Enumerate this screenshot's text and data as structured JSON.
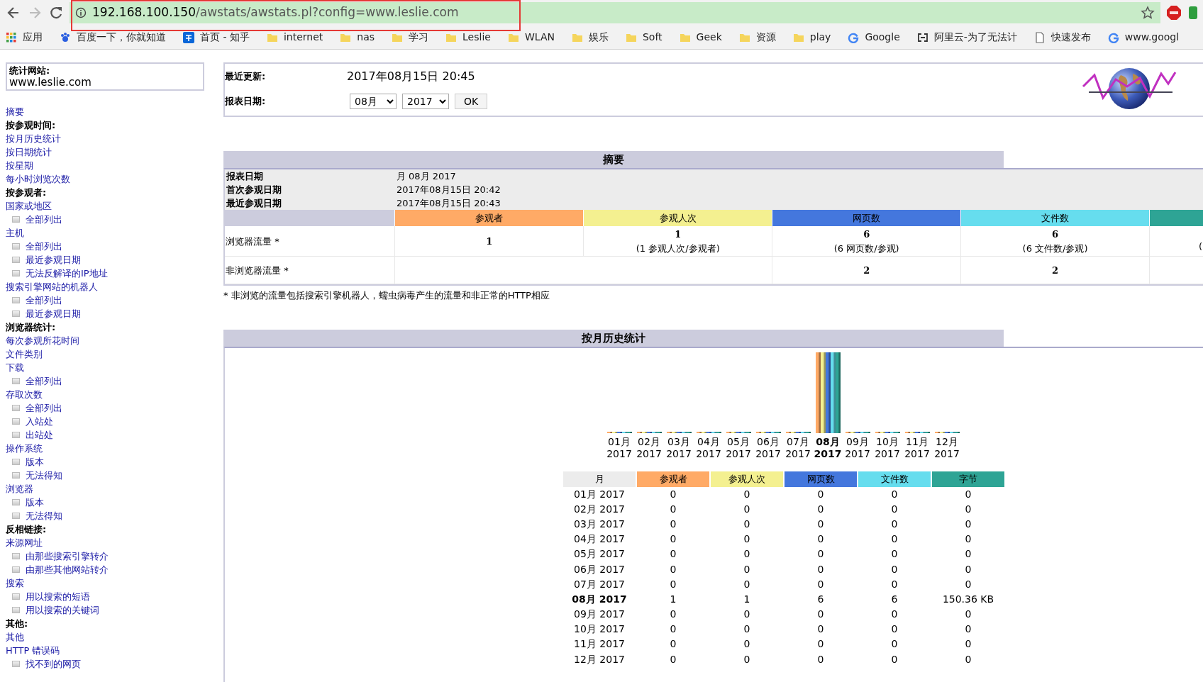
{
  "browser": {
    "url": {
      "host": "192.168.100.150",
      "path": "/awstats/awstats.pl?config=www.leslie.com"
    },
    "bookmarks": [
      {
        "kind": "apps",
        "label": "应用"
      },
      {
        "kind": "baidu",
        "label": "百度一下，你就知道"
      },
      {
        "kind": "zhihu",
        "label": "首页 - 知乎"
      },
      {
        "kind": "folder",
        "label": "internet"
      },
      {
        "kind": "folder",
        "label": "nas"
      },
      {
        "kind": "folder",
        "label": "学习"
      },
      {
        "kind": "folder",
        "label": "Leslie"
      },
      {
        "kind": "folder",
        "label": "WLAN"
      },
      {
        "kind": "folder",
        "label": "娱乐"
      },
      {
        "kind": "folder",
        "label": "Soft"
      },
      {
        "kind": "folder",
        "label": "Geek"
      },
      {
        "kind": "folder",
        "label": "资源"
      },
      {
        "kind": "folder",
        "label": "play"
      },
      {
        "kind": "google",
        "label": "Google"
      },
      {
        "kind": "aliyun",
        "label": "阿里云-为了无法计"
      },
      {
        "kind": "page",
        "label": "快速发布"
      },
      {
        "kind": "google",
        "label": "www.googl"
      }
    ]
  },
  "sidebar": {
    "site_label": "统计网站:",
    "site": "www.leslie.com",
    "menu": [
      {
        "kind": "link",
        "label": "摘要"
      },
      {
        "kind": "heading",
        "label": "按参观时间:"
      },
      {
        "kind": "link",
        "label": "按月历史统计"
      },
      {
        "kind": "link",
        "label": "按日期统计"
      },
      {
        "kind": "link",
        "label": "按星期"
      },
      {
        "kind": "link",
        "label": "每小时浏览次数"
      },
      {
        "kind": "heading",
        "label": "按参观者:"
      },
      {
        "kind": "link",
        "label": "国家或地区",
        "children": [
          {
            "label": "全部列出"
          }
        ]
      },
      {
        "kind": "link",
        "label": "主机",
        "children": [
          {
            "label": "全部列出"
          },
          {
            "label": "最近参观日期"
          },
          {
            "label": "无法反解译的IP地址"
          }
        ]
      },
      {
        "kind": "link",
        "label": "搜索引擎网站的机器人",
        "children": [
          {
            "label": "全部列出"
          },
          {
            "label": "最近参观日期"
          }
        ]
      },
      {
        "kind": "heading",
        "label": "浏览器统计:"
      },
      {
        "kind": "link",
        "label": "每次参观所花时间"
      },
      {
        "kind": "link",
        "label": "文件类别"
      },
      {
        "kind": "link",
        "label": "下载",
        "children": [
          {
            "label": "全部列出"
          }
        ]
      },
      {
        "kind": "link",
        "label": "存取次数",
        "children": [
          {
            "label": "全部列出"
          },
          {
            "label": "入站处"
          },
          {
            "label": "出站处"
          }
        ]
      },
      {
        "kind": "link",
        "label": "操作系统",
        "children": [
          {
            "label": "版本"
          },
          {
            "label": "无法得知"
          }
        ]
      },
      {
        "kind": "link",
        "label": "浏览器",
        "children": [
          {
            "label": "版本"
          },
          {
            "label": "无法得知"
          }
        ]
      },
      {
        "kind": "heading",
        "label": "反相链接:"
      },
      {
        "kind": "link",
        "label": "来源网址",
        "children": [
          {
            "label": "由那些搜索引擎转介"
          },
          {
            "label": "由那些其他网站转介"
          }
        ]
      },
      {
        "kind": "link",
        "label": "搜索",
        "children": [
          {
            "label": "用以搜索的短语"
          },
          {
            "label": "用以搜索的关键词"
          }
        ]
      },
      {
        "kind": "heading",
        "label": "其他:"
      },
      {
        "kind": "link",
        "label": "其他"
      },
      {
        "kind": "link",
        "label": "HTTP 错误码",
        "children": [
          {
            "label": "找不到的网页"
          }
        ]
      }
    ]
  },
  "header": {
    "last_update": {
      "label": "最近更新:",
      "value": "2017年08月15日 20:45"
    },
    "report_date": {
      "label": "报表日期:",
      "month": "08月",
      "year": "2017",
      "button": "OK"
    }
  },
  "summary": {
    "title": "摘要",
    "info": [
      {
        "label": "报表日期",
        "value": "月 08月 2017"
      },
      {
        "label": "首次参观日期",
        "value": "2017年08月15日 20:42"
      },
      {
        "label": "最近参观日期",
        "value": "2017年08月15日 20:43"
      }
    ],
    "columns": [
      {
        "label": "参观者",
        "color": "#ffaa66"
      },
      {
        "label": "参观人次",
        "color": "#f4f090"
      },
      {
        "label": "网页数",
        "color": "#4477dd"
      },
      {
        "label": "文件数",
        "color": "#66ddee"
      },
      {
        "color": "#2ea495"
      }
    ],
    "rows": [
      {
        "label": "浏览器流量 *",
        "cells": [
          {
            "value": "1"
          },
          {
            "value": "1",
            "sub": "(1 参观人次/参观者)"
          },
          {
            "value": "6",
            "sub": "(6 网页数/参观)"
          },
          {
            "value": "6",
            "sub": "(6 文件数/参观)"
          },
          {
            "sub": "("
          }
        ]
      },
      {
        "label": "非浏览器流量 *",
        "cells": [
          {},
          {},
          {
            "value": "2"
          },
          {
            "value": "2"
          }
        ]
      }
    ],
    "footnote": "* 非浏览的流量包括搜索引擎机器人，蠕虫病毒产生的流量和非正常的HTTP相应"
  },
  "history": {
    "title": "按月历史统计",
    "months": [
      {
        "month": "01月",
        "year": "2017",
        "selected": false
      },
      {
        "month": "02月",
        "year": "2017",
        "selected": false
      },
      {
        "month": "03月",
        "year": "2017",
        "selected": false
      },
      {
        "month": "04月",
        "year": "2017",
        "selected": false
      },
      {
        "month": "05月",
        "year": "2017",
        "selected": false
      },
      {
        "month": "06月",
        "year": "2017",
        "selected": false
      },
      {
        "month": "07月",
        "year": "2017",
        "selected": false
      },
      {
        "month": "08月",
        "year": "2017",
        "selected": true
      },
      {
        "month": "09月",
        "year": "2017",
        "selected": false
      },
      {
        "month": "10月",
        "year": "2017",
        "selected": false
      },
      {
        "month": "11月",
        "year": "2017",
        "selected": false
      },
      {
        "month": "12月",
        "year": "2017",
        "selected": false
      }
    ],
    "columns": [
      {
        "label": "月",
        "color": "#ececec"
      },
      {
        "label": "参观者",
        "color": "#ffaa66"
      },
      {
        "label": "参观人次",
        "color": "#f4f090"
      },
      {
        "label": "网页数",
        "color": "#4477dd"
      },
      {
        "label": "文件数",
        "color": "#66ddee"
      },
      {
        "label": "字节",
        "color": "#2ea495"
      }
    ],
    "rows": [
      {
        "month": "01月 2017",
        "values": [
          "0",
          "0",
          "0",
          "0",
          "0"
        ],
        "selected": false
      },
      {
        "month": "02月 2017",
        "values": [
          "0",
          "0",
          "0",
          "0",
          "0"
        ],
        "selected": false
      },
      {
        "month": "03月 2017",
        "values": [
          "0",
          "0",
          "0",
          "0",
          "0"
        ],
        "selected": false
      },
      {
        "month": "04月 2017",
        "values": [
          "0",
          "0",
          "0",
          "0",
          "0"
        ],
        "selected": false
      },
      {
        "month": "05月 2017",
        "values": [
          "0",
          "0",
          "0",
          "0",
          "0"
        ],
        "selected": false
      },
      {
        "month": "06月 2017",
        "values": [
          "0",
          "0",
          "0",
          "0",
          "0"
        ],
        "selected": false
      },
      {
        "month": "07月 2017",
        "values": [
          "0",
          "0",
          "0",
          "0",
          "0"
        ],
        "selected": false
      },
      {
        "month": "08月 2017",
        "values": [
          "1",
          "1",
          "6",
          "6",
          "150.36 KB"
        ],
        "selected": true
      },
      {
        "month": "09月 2017",
        "values": [
          "0",
          "0",
          "0",
          "0",
          "0"
        ],
        "selected": false
      },
      {
        "month": "10月 2017",
        "values": [
          "0",
          "0",
          "0",
          "0",
          "0"
        ],
        "selected": false
      },
      {
        "month": "11月 2017",
        "values": [
          "0",
          "0",
          "0",
          "0",
          "0"
        ],
        "selected": false
      },
      {
        "month": "12月 2017",
        "values": [
          "0",
          "0",
          "0",
          "0",
          "0"
        ],
        "selected": false
      }
    ]
  }
}
